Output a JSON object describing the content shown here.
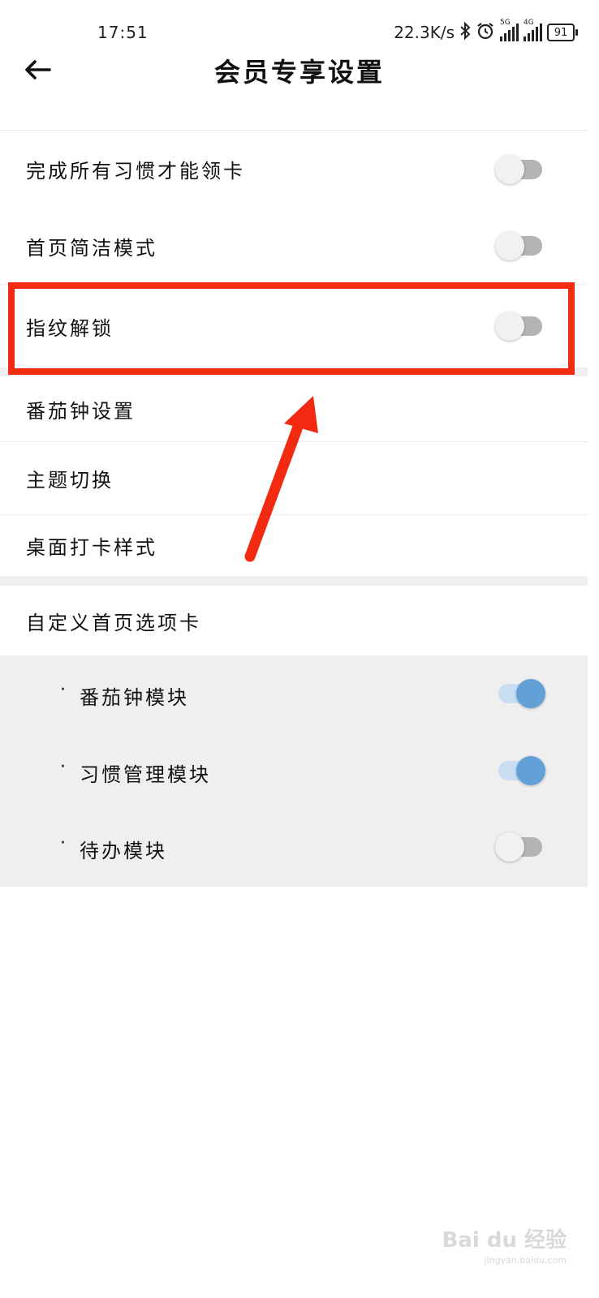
{
  "status_bar": {
    "time": "17:51",
    "network_speed": "22.3K/s",
    "icons": [
      "bluetooth-icon",
      "alarm-icon",
      "signal-5g-icon",
      "signal-4g-icon"
    ],
    "sig1_tag": "5G",
    "sig2_tag": "4G",
    "battery": "91"
  },
  "header": {
    "title": "会员专享设置",
    "back_icon": "arrow-left-icon"
  },
  "settings": {
    "items": [
      {
        "label": "完成所有习惯才能领卡",
        "toggle": false
      },
      {
        "label": "首页简洁模式",
        "toggle": false
      },
      {
        "label": "指纹解锁",
        "toggle": false,
        "highlighted": true
      },
      {
        "label": "番茄钟设置"
      },
      {
        "label": "主题切换"
      },
      {
        "label": "桌面打卡样式"
      },
      {
        "label": "自定义首页选项卡"
      }
    ]
  },
  "custom_tabs": {
    "bullet": "·",
    "items": [
      {
        "label": "番茄钟模块",
        "toggle": true
      },
      {
        "label": "习惯管理模块",
        "toggle": true
      },
      {
        "label": "待办模块",
        "toggle": false
      }
    ]
  },
  "colors": {
    "annotation": "#f32a12",
    "toggle_on": "#64a0d8",
    "toggle_off_track": "#b4b4b4",
    "section_bg": "#efefef"
  },
  "watermark": {
    "brand": "Bai du 经验",
    "url": "jingyan.baidu.com"
  }
}
